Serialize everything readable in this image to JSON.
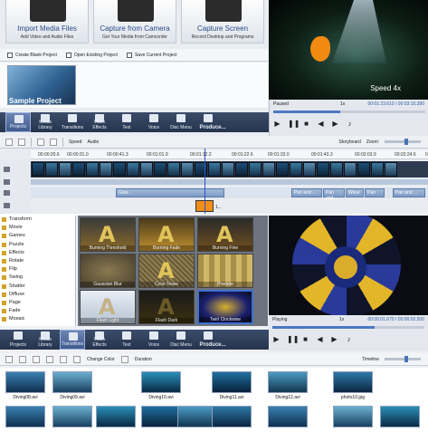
{
  "top": {
    "capture": [
      {
        "title": "Import Media Files",
        "subtitle": "Add Video and Audio Files"
      },
      {
        "title": "Capture from Camera",
        "subtitle": "Get Your Media from Camcorder"
      },
      {
        "title": "Capture Screen",
        "subtitle": "Record Desktop and Programs"
      }
    ],
    "project_buttons": [
      "Create Blank Project",
      "Open Existing Project",
      "Save Current Project"
    ],
    "sample_project": "Sample Project",
    "preview_overlay": "Speed 4x",
    "player": {
      "status": "Paused",
      "zoom": "1x",
      "time": "00:01:23.610 / 00:03:10.390",
      "progress": 0.44
    },
    "toolbar": [
      "Projects",
      "Media Library",
      "Transitions",
      "Video Effects",
      "Text",
      "Voice",
      "Disc Menu",
      "Produce..."
    ],
    "timeline_toolbar": {
      "speed": "Speed",
      "audio": "Audio",
      "storyboard": "Storyboard",
      "zoom": "Zoom:"
    },
    "ruler": [
      "00:00:20.6",
      "00:00:31.0",
      "00:00:41.3",
      "00:01:01.9",
      "00:01:12.2",
      "00:01:22.6",
      "00:01:33.0",
      "00:01:43.3",
      "00:02:03.9",
      "00:02:24.6",
      "00:02:45.2"
    ],
    "effects_on_track": [
      "Glas...",
      "Pan and ...",
      "Pan and ...",
      "Wave",
      "Pan",
      "Pan and ..."
    ],
    "fish_clip": "1..."
  },
  "bottom": {
    "categories": [
      "Transform",
      "Movie",
      "Games",
      "Puzzle",
      "Effects",
      "Rotate",
      "Flip",
      "Swing",
      "Shatter",
      "Diffuse",
      "Page",
      "Fade",
      "Mosaic"
    ],
    "effects": [
      "Burning Threshold",
      "Burning Fade",
      "Burning Fine",
      "Gaussian Blur",
      "Color Noise",
      "Pixelate",
      "Flash Light",
      "Flash Dark",
      "Twirl Clockwise"
    ],
    "effect_glyph": "A",
    "player": {
      "status": "Playing",
      "zoom": "1x",
      "time": "00:00:01.670 / 00:00:02.500",
      "progress": 0.67
    },
    "toolbar": [
      "Projects",
      "Media Library",
      "Transitions",
      "Video Effects",
      "Text",
      "Voice",
      "Disc Menu",
      "Produce..."
    ],
    "media_toolbar": {
      "change_color": "Change Color",
      "duration": "Duration",
      "timeline": "Timeline"
    },
    "files": [
      "Diving08.avi",
      "Diving09.avi",
      "Diving10.avi",
      "Diving11.avi",
      "Diving12.avi",
      "photo10.jpg"
    ]
  }
}
